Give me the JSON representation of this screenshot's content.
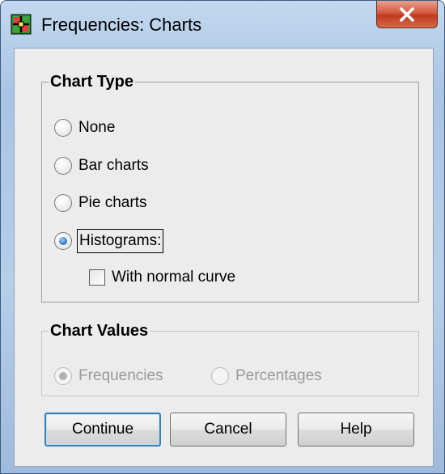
{
  "window": {
    "title": "Frequencies: Charts",
    "icon": "spss-app-icon",
    "close_icon": "close-x-icon"
  },
  "chart_type": {
    "label": "Chart Type",
    "options": [
      {
        "label": "None",
        "selected": false
      },
      {
        "label": "Bar charts",
        "selected": false
      },
      {
        "label": "Pie charts",
        "selected": false
      },
      {
        "label": "Histograms:",
        "selected": true
      }
    ],
    "normal_curve": {
      "label": "With normal curve",
      "checked": false
    }
  },
  "chart_values": {
    "label": "Chart Values",
    "enabled": false,
    "options": [
      {
        "label": "Frequencies",
        "selected": true
      },
      {
        "label": "Percentages",
        "selected": false
      }
    ]
  },
  "buttons": {
    "continue": "Continue",
    "cancel": "Cancel",
    "help": "Help"
  },
  "colors": {
    "title_bar": "#b7cee8",
    "close_button": "#c0391d",
    "dialog_bg": "#ececec",
    "radio_selected": "#2b6fb8",
    "default_button_border": "#3c7fb1",
    "disabled_text": "#9a9a9a"
  }
}
